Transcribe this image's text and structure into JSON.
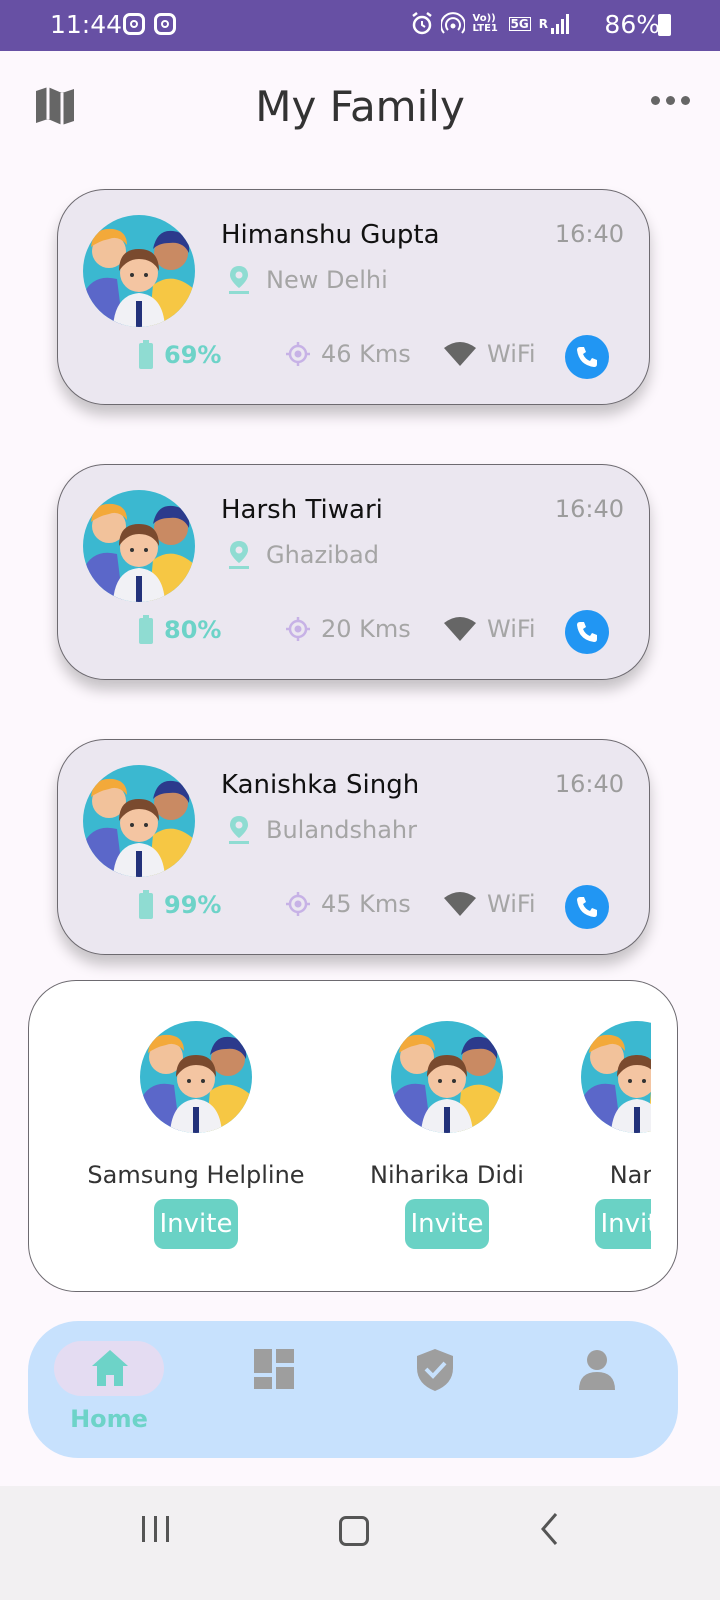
{
  "status_bar": {
    "time": "11:44",
    "battery": "86%",
    "icons": [
      "instagram-icon",
      "instagram-icon",
      "alarm-icon",
      "hotspot-icon",
      "volte-icon",
      "5g-icon",
      "signal-icon",
      "battery-icon"
    ],
    "volte_label": "Vo)) LTE1",
    "network_label": "5G",
    "roaming_label": "R"
  },
  "header": {
    "title": "My Family",
    "left_icon": "map-icon",
    "right_icon": "more-horizontal-icon"
  },
  "members": [
    {
      "name": "Himanshu Gupta",
      "time": "16:40",
      "location": "New Delhi",
      "battery": "69%",
      "distance": "46 Kms",
      "network": "WiFi"
    },
    {
      "name": "Harsh Tiwari",
      "time": "16:40",
      "location": "Ghazibad",
      "battery": "80%",
      "distance": "20 Kms",
      "network": "WiFi"
    },
    {
      "name": "Kanishka Singh",
      "time": "16:40",
      "location": "Bulandshahr",
      "battery": "99%",
      "distance": "45 Kms",
      "network": "WiFi"
    }
  ],
  "suggestions": [
    {
      "name": "Samsung Helpline",
      "action": "Invite"
    },
    {
      "name": "Niharika Didi",
      "action": "Invite"
    },
    {
      "name": "Nani",
      "action": "Invite"
    }
  ],
  "bottom_nav": {
    "items": [
      {
        "label": "Home",
        "icon": "home-icon",
        "active": true
      },
      {
        "label": "",
        "icon": "dashboard-icon",
        "active": false
      },
      {
        "label": "",
        "icon": "shield-icon",
        "active": false
      },
      {
        "label": "",
        "icon": "profile-icon",
        "active": false
      }
    ]
  },
  "colors": {
    "status_bar": "#6750a4",
    "accent_teal": "#6dd3c8",
    "call_blue": "#2196f3",
    "card_bg": "#ebe7f0",
    "nav_bg": "#c7e1fd"
  }
}
